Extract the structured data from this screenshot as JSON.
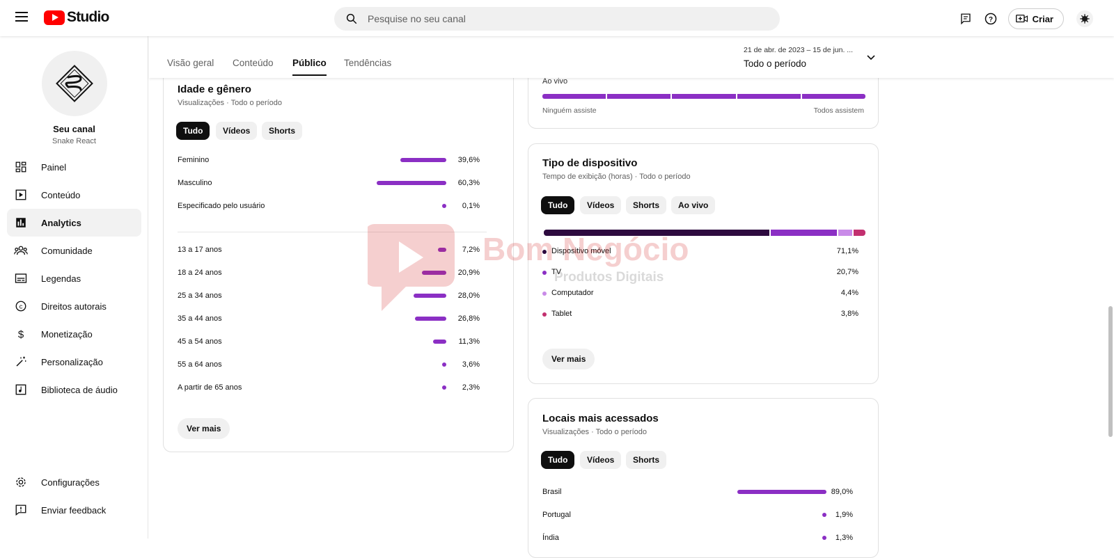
{
  "header": {
    "logo_text": "Studio",
    "search_placeholder": "Pesquise no seu canal",
    "create_label": "Criar"
  },
  "sidebar": {
    "channel_name": "Seu canal",
    "channel_handle": "Snake React",
    "items": [
      {
        "label": "Painel",
        "icon": "dashboard-icon"
      },
      {
        "label": "Conteúdo",
        "icon": "content-icon"
      },
      {
        "label": "Analytics",
        "icon": "analytics-icon",
        "active": true
      },
      {
        "label": "Comunidade",
        "icon": "community-icon"
      },
      {
        "label": "Legendas",
        "icon": "subtitles-icon"
      },
      {
        "label": "Direitos autorais",
        "icon": "copyright-icon"
      },
      {
        "label": "Monetização",
        "icon": "dollar-icon"
      },
      {
        "label": "Personalização",
        "icon": "magic-wand-icon"
      },
      {
        "label": "Biblioteca de áudio",
        "icon": "audio-library-icon"
      }
    ],
    "bottom_items": [
      {
        "label": "Configurações",
        "icon": "gear-icon"
      },
      {
        "label": "Enviar feedback",
        "icon": "feedback-icon"
      }
    ]
  },
  "tabs": [
    "Visão geral",
    "Conteúdo",
    "Público",
    "Tendências"
  ],
  "active_tab": "Público",
  "date_range": {
    "range": "21 de abr. de 2023 – 15 de jun. ...",
    "period": "Todo o período"
  },
  "age_gender": {
    "title": "Idade e gênero",
    "subtitle": "Visualizações · Todo o período",
    "chips": [
      "Tudo",
      "Vídeos",
      "Shorts"
    ],
    "gender": [
      {
        "label": "Feminino",
        "value": "39,6%",
        "pct": 39.6
      },
      {
        "label": "Masculino",
        "value": "60,3%",
        "pct": 60.3
      },
      {
        "label": "Especificado pelo usuário",
        "value": "0,1%",
        "pct": 0.1
      }
    ],
    "age": [
      {
        "label": "13 a 17 anos",
        "value": "7,2%",
        "pct": 7.2
      },
      {
        "label": "18 a 24 anos",
        "value": "20,9%",
        "pct": 20.9
      },
      {
        "label": "25 a 34 anos",
        "value": "28,0%",
        "pct": 28.0
      },
      {
        "label": "35 a 44 anos",
        "value": "26,8%",
        "pct": 26.8
      },
      {
        "label": "45 a 54 anos",
        "value": "11,3%",
        "pct": 11.3
      },
      {
        "label": "55 a 64 anos",
        "value": "3,6%",
        "pct": 3.6
      },
      {
        "label": "A partir de 65 anos",
        "value": "2,3%",
        "pct": 2.3
      }
    ],
    "more": "Ver mais"
  },
  "live_card": {
    "label": "Ao vivo",
    "left_label": "Ninguém assiste",
    "right_label": "Todos assistem"
  },
  "device": {
    "title": "Tipo de dispositivo",
    "subtitle": "Tempo de exibição (horas) · Todo o período",
    "chips": [
      "Tudo",
      "Vídeos",
      "Shorts",
      "Ao vivo"
    ],
    "items": [
      {
        "label": "Dispositivo móvel",
        "value": "71,1%",
        "pct": 71.1,
        "color": "#2d0a3f"
      },
      {
        "label": "TV",
        "value": "20,7%",
        "pct": 20.7,
        "color": "#8b2fc4"
      },
      {
        "label": "Computador",
        "value": "4,4%",
        "pct": 4.4,
        "color": "#c98be8"
      },
      {
        "label": "Tablet",
        "value": "3,8%",
        "pct": 3.8,
        "color": "#c2306f"
      }
    ],
    "more": "Ver mais"
  },
  "locations": {
    "title": "Locais mais acessados",
    "subtitle": "Visualizações · Todo o período",
    "chips": [
      "Tudo",
      "Vídeos",
      "Shorts"
    ],
    "items": [
      {
        "label": "Brasil",
        "value": "89,0%",
        "pct": 89.0
      },
      {
        "label": "Portugal",
        "value": "1,9%",
        "pct": 1.9
      },
      {
        "label": "Índia",
        "value": "1,3%",
        "pct": 1.3
      }
    ]
  },
  "watermark": {
    "brand": "Bom Negócio",
    "tagline": "Produtos Digitais"
  },
  "colors": {
    "accent": "#8b2fc4",
    "youtube_red": "#ff0000"
  }
}
